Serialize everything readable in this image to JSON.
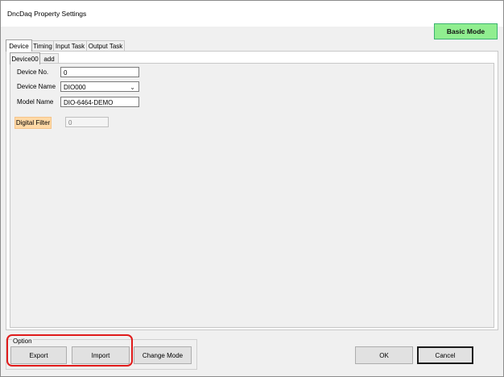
{
  "window": {
    "title": "DncDaq Property Settings"
  },
  "mode_button": {
    "label": "Basic Mode",
    "color": "#90ee90"
  },
  "tabs": [
    {
      "label": "Device",
      "active": true
    },
    {
      "label": "Timing",
      "active": false
    },
    {
      "label": "Input Task",
      "active": false
    },
    {
      "label": "Output Task",
      "active": false
    }
  ],
  "subtabs": [
    {
      "label": "Device00",
      "active": true
    },
    {
      "label": "add",
      "active": false
    }
  ],
  "device": {
    "device_no_label": "Device No.",
    "device_no_value": "0",
    "device_name_label": "Device Name",
    "device_name_value": "DIO000",
    "model_name_label": "Model Name",
    "model_name_value": "DIO-6464-DEMO",
    "digital_filter_label": "Digital Filter",
    "digital_filter_value": "0"
  },
  "option_group": {
    "legend": "Option",
    "export_label": "Export",
    "import_label": "Import",
    "change_mode_label": "Change Mode"
  },
  "dialog_buttons": {
    "ok_label": "OK",
    "cancel_label": "Cancel"
  },
  "annotation": {
    "highlight_color": "#e01b1b"
  },
  "icons": {
    "combo_dropdown": "chevron-down-icon"
  }
}
